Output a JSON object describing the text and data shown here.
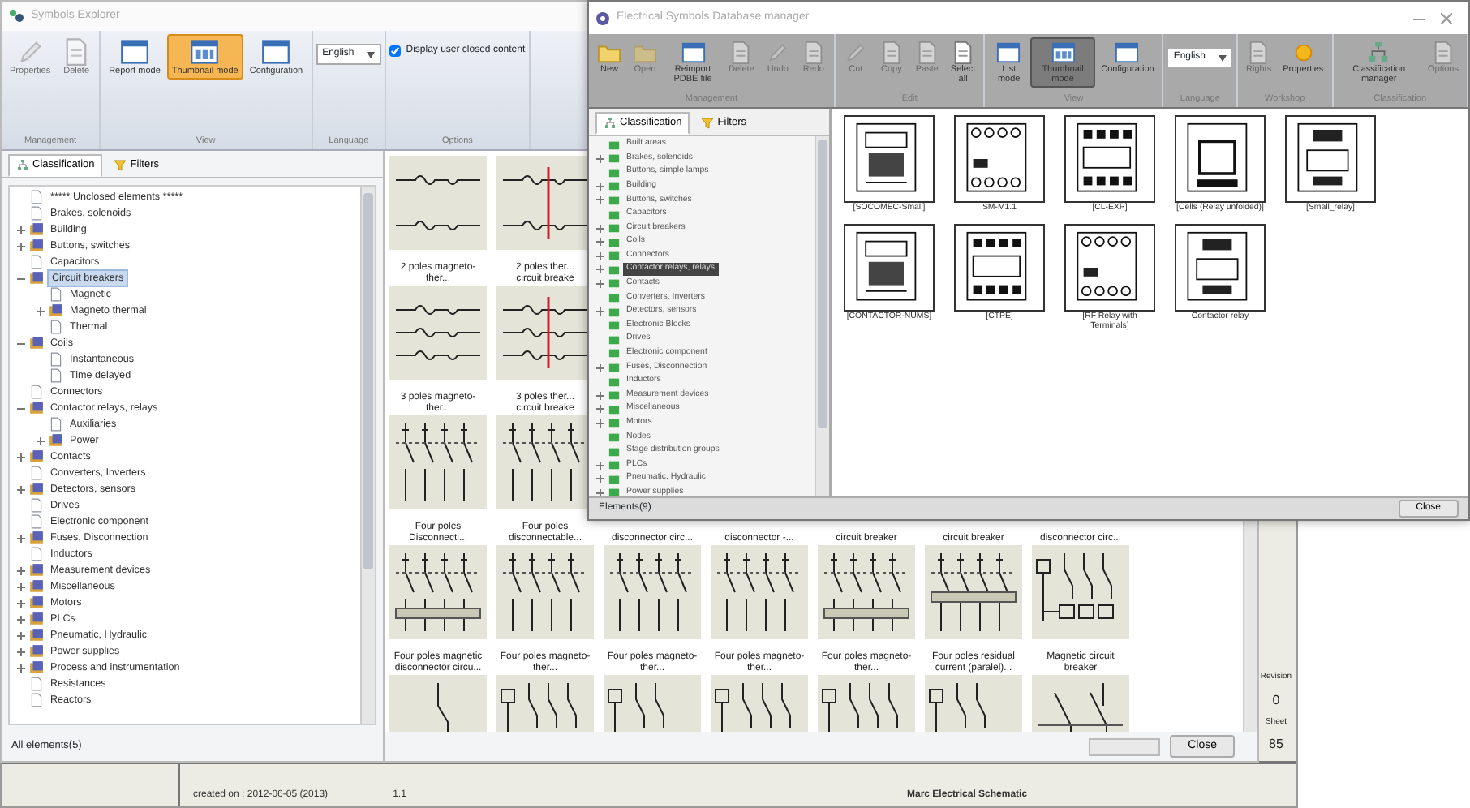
{
  "back_window": {
    "title": "Symbols Explorer",
    "ribbon": [
      {
        "label": "Management",
        "items": [
          {
            "kind": "button",
            "label": "Properties",
            "disabled": true,
            "selected": false
          },
          {
            "kind": "button",
            "label": "Delete",
            "disabled": true,
            "selected": false
          }
        ]
      },
      {
        "label": "View",
        "items": [
          {
            "kind": "button",
            "label": "Report mode",
            "disabled": false,
            "selected": false
          },
          {
            "kind": "button",
            "label": "Thumbnail mode",
            "disabled": false,
            "selected": true
          },
          {
            "kind": "button",
            "label": "Configuration",
            "disabled": false,
            "selected": false
          }
        ]
      },
      {
        "label": "Language",
        "items": [
          {
            "kind": "dropdown",
            "value": "English"
          }
        ]
      },
      {
        "label": "Options",
        "items": [
          {
            "kind": "checkbox",
            "label": "Display user closed content",
            "checked": true
          }
        ]
      }
    ],
    "tabs": [
      {
        "label": "Classification",
        "selected": true
      },
      {
        "label": "Filters",
        "selected": false
      }
    ],
    "tree": [
      {
        "label": "***** Unclosed elements *****",
        "selected": false
      },
      {
        "label": "Brakes, solenoids",
        "selected": false
      },
      {
        "label": "Building",
        "expanded": false,
        "selected": false
      },
      {
        "label": "Buttons, switches",
        "expanded": false,
        "selected": false
      },
      {
        "label": "Capacitors",
        "selected": false
      },
      {
        "label": "Circuit breakers",
        "expanded": true,
        "selected": true,
        "children": [
          {
            "label": "Magnetic",
            "selected": false
          },
          {
            "label": "Magneto thermal",
            "expanded": false,
            "selected": false
          },
          {
            "label": "Thermal",
            "selected": false
          }
        ]
      },
      {
        "label": "Coils",
        "expanded": true,
        "selected": false,
        "children": [
          {
            "label": "Instantaneous",
            "selected": false
          },
          {
            "label": "Time delayed",
            "selected": false
          }
        ]
      },
      {
        "label": "Connectors",
        "selected": false
      },
      {
        "label": "Contactor relays, relays",
        "expanded": true,
        "selected": false,
        "children": [
          {
            "label": "Auxiliaries",
            "selected": false
          },
          {
            "label": "Power",
            "expanded": false,
            "selected": false
          }
        ]
      },
      {
        "label": "Contacts",
        "expanded": false,
        "selected": false
      },
      {
        "label": "Converters, Inverters",
        "selected": false
      },
      {
        "label": "Detectors, sensors",
        "expanded": false,
        "selected": false
      },
      {
        "label": "Drives",
        "selected": false
      },
      {
        "label": "Electronic component",
        "selected": false
      },
      {
        "label": "Fuses, Disconnection",
        "expanded": false,
        "selected": false
      },
      {
        "label": "Inductors",
        "selected": false
      },
      {
        "label": "Measurement devices",
        "expanded": false,
        "selected": false
      },
      {
        "label": "Miscellaneous",
        "expanded": false,
        "selected": false
      },
      {
        "label": "Motors",
        "expanded": false,
        "selected": false
      },
      {
        "label": "PLCs",
        "expanded": false,
        "selected": false
      },
      {
        "label": "Pneumatic, Hydraulic",
        "expanded": false,
        "selected": false
      },
      {
        "label": "Power supplies",
        "expanded": false,
        "selected": false
      },
      {
        "label": "Process and instrumentation",
        "expanded": false,
        "selected": false
      },
      {
        "label": "Resistances",
        "selected": false
      },
      {
        "label": "Reactors",
        "selected": false
      }
    ],
    "status": "All elements(5)",
    "thumbnail_rows": [
      [
        {
          "label": "2 poles magneto-ther...",
          "kind": "thermal-2"
        },
        {
          "label": "2 poles ther... circuit breake",
          "kind": "linked-2"
        }
      ],
      [
        {
          "label": "3 poles magneto-ther...",
          "kind": "thermal-3"
        },
        {
          "label": "3 poles ther... circuit breake",
          "kind": "linked-3"
        }
      ],
      [
        {
          "label": "Four poles Disconnecti...",
          "kind": "switch-4"
        },
        {
          "label": "Four poles disconnectable...",
          "kind": "switch-4"
        },
        {
          "label": "disconnector circ..."
        },
        {
          "label": "disconnector -..."
        },
        {
          "label": "circuit breaker"
        },
        {
          "label": "circuit breaker"
        },
        {
          "label": "disconnector circ..."
        }
      ],
      [
        {
          "label": "Four poles magnetic disconnector circu...",
          "kind": "switch-4-bar"
        },
        {
          "label": "Four poles magneto-ther...",
          "kind": "switch-4"
        },
        {
          "label": "Four poles magneto-ther...",
          "kind": "switch-4"
        },
        {
          "label": "Four poles magneto-ther...",
          "kind": "switch-4"
        },
        {
          "label": "Four poles magneto-ther...",
          "kind": "switch-4-bar"
        },
        {
          "label": "Four poles residual current (paralel)...",
          "kind": "switch-bar-low"
        },
        {
          "label": "Magnetic circuit breaker",
          "kind": "coil-3"
        }
      ],
      [
        {
          "kind": "single"
        },
        {
          "kind": "coil-3"
        },
        {
          "kind": "coil-2"
        },
        {
          "kind": "coil-3"
        },
        {
          "kind": "coil-3"
        },
        {
          "kind": "coil-2"
        },
        {
          "kind": "magnetic"
        }
      ]
    ],
    "close_button": "Close"
  },
  "sheet": {
    "created": "created on : 2012-06-05 (2013)",
    "version": "1.1",
    "company": "Marc Electrical Schematic",
    "revision_label": "Revision",
    "revision": "0",
    "sheet_label": "Sheet",
    "sheet": "85"
  },
  "front_window": {
    "title": "Electrical Symbols Database manager",
    "ribbon": [
      {
        "label": "Management",
        "items": [
          {
            "kind": "button",
            "label": "New",
            "disabled": false,
            "selected": false
          },
          {
            "kind": "button",
            "label": "Open",
            "disabled": true,
            "selected": false
          },
          {
            "kind": "button",
            "label": "Reimport PDBE file",
            "disabled": false,
            "selected": false
          },
          {
            "kind": "button",
            "label": "Delete",
            "disabled": true,
            "selected": false
          },
          {
            "kind": "button",
            "label": "Undo",
            "disabled": true,
            "selected": false
          },
          {
            "kind": "button",
            "label": "Redo",
            "disabled": true,
            "selected": false
          }
        ]
      },
      {
        "label": "Edit",
        "items": [
          {
            "kind": "button",
            "label": "Cut",
            "disabled": true,
            "selected": false
          },
          {
            "kind": "button",
            "label": "Copy",
            "disabled": true,
            "selected": false
          },
          {
            "kind": "button",
            "label": "Paste",
            "disabled": true,
            "selected": false
          },
          {
            "kind": "button",
            "label": "Select all",
            "disabled": false,
            "selected": false
          }
        ]
      },
      {
        "label": "View",
        "items": [
          {
            "kind": "button",
            "label": "List mode",
            "disabled": false,
            "selected": false
          },
          {
            "kind": "button",
            "label": "Thumbnail mode",
            "disabled": false,
            "selected": true
          },
          {
            "kind": "button",
            "label": "Configuration",
            "disabled": false,
            "selected": false
          }
        ]
      },
      {
        "label": "Language",
        "items": [
          {
            "kind": "dropdown",
            "value": "English"
          }
        ]
      },
      {
        "label": "Workshop",
        "items": [
          {
            "kind": "button",
            "label": "Rights",
            "disabled": true,
            "selected": false
          },
          {
            "kind": "button",
            "label": "Properties",
            "disabled": false,
            "selected": false
          }
        ]
      },
      {
        "label": "Classification",
        "items": [
          {
            "kind": "button",
            "label": "Classification manager",
            "disabled": false,
            "selected": false
          },
          {
            "kind": "button",
            "label": "Options",
            "disabled": true,
            "selected": false
          }
        ]
      }
    ],
    "tabs": [
      {
        "label": "Classification",
        "selected": true
      },
      {
        "label": "Filters",
        "selected": false
      }
    ],
    "tree": [
      {
        "label": "Built areas",
        "selected": false
      },
      {
        "label": "Brakes, solenoids",
        "expanded": false,
        "selected": false
      },
      {
        "label": "Buttons, simple lamps",
        "selected": false
      },
      {
        "label": "Building",
        "expanded": false,
        "selected": false
      },
      {
        "label": "Buttons, switches",
        "expanded": false,
        "selected": false
      },
      {
        "label": "Capacitors",
        "selected": false
      },
      {
        "label": "Circuit breakers",
        "expanded": false,
        "selected": false
      },
      {
        "label": "Coils",
        "expanded": false,
        "selected": false
      },
      {
        "label": "Connectors",
        "expanded": false,
        "selected": false
      },
      {
        "label": "Contactor relays, relays",
        "expanded": false,
        "selected": true
      },
      {
        "label": "Contacts",
        "expanded": false,
        "selected": false
      },
      {
        "label": "Converters, Inverters",
        "selected": false
      },
      {
        "label": "Detectors, sensors",
        "expanded": false,
        "selected": false
      },
      {
        "label": "Electronic Blocks",
        "selected": false
      },
      {
        "label": "Drives",
        "selected": false
      },
      {
        "label": "Electronic component",
        "selected": false
      },
      {
        "label": "Fuses, Disconnection",
        "expanded": false,
        "selected": false
      },
      {
        "label": "Inductors",
        "selected": false
      },
      {
        "label": "Measurement devices",
        "expanded": false,
        "selected": false
      },
      {
        "label": "Miscellaneous",
        "expanded": false,
        "selected": false
      },
      {
        "label": "Motors",
        "expanded": false,
        "selected": false
      },
      {
        "label": "Nodes",
        "selected": false
      },
      {
        "label": "Stage distribution groups",
        "selected": false
      },
      {
        "label": "PLCs",
        "expanded": false,
        "selected": false
      },
      {
        "label": "Pneumatic, Hydraulic",
        "expanded": false,
        "selected": false
      },
      {
        "label": "Power supplies",
        "expanded": false,
        "selected": false
      }
    ],
    "thumbnails": [
      {
        "label": "[SOCOMEC-Small]",
        "kind": "module"
      },
      {
        "label": "SM-M1.1",
        "kind": "terminal"
      },
      {
        "label": "[CL-EXP]",
        "kind": "contactor"
      },
      {
        "label": "[Cells (Relay unfolded)]",
        "kind": "coilbox"
      },
      {
        "label": "[Small_relay]",
        "kind": "relay"
      },
      {
        "label": "[CONTACTOR-NUMS]",
        "kind": "module"
      },
      {
        "label": "[CTPE]",
        "kind": "contactor"
      },
      {
        "label": "[RF Relay with Terminals]",
        "kind": "terminal"
      },
      {
        "label": "Contactor relay",
        "kind": "relay"
      }
    ],
    "status": "Elements(9)",
    "close_button": "Close"
  }
}
